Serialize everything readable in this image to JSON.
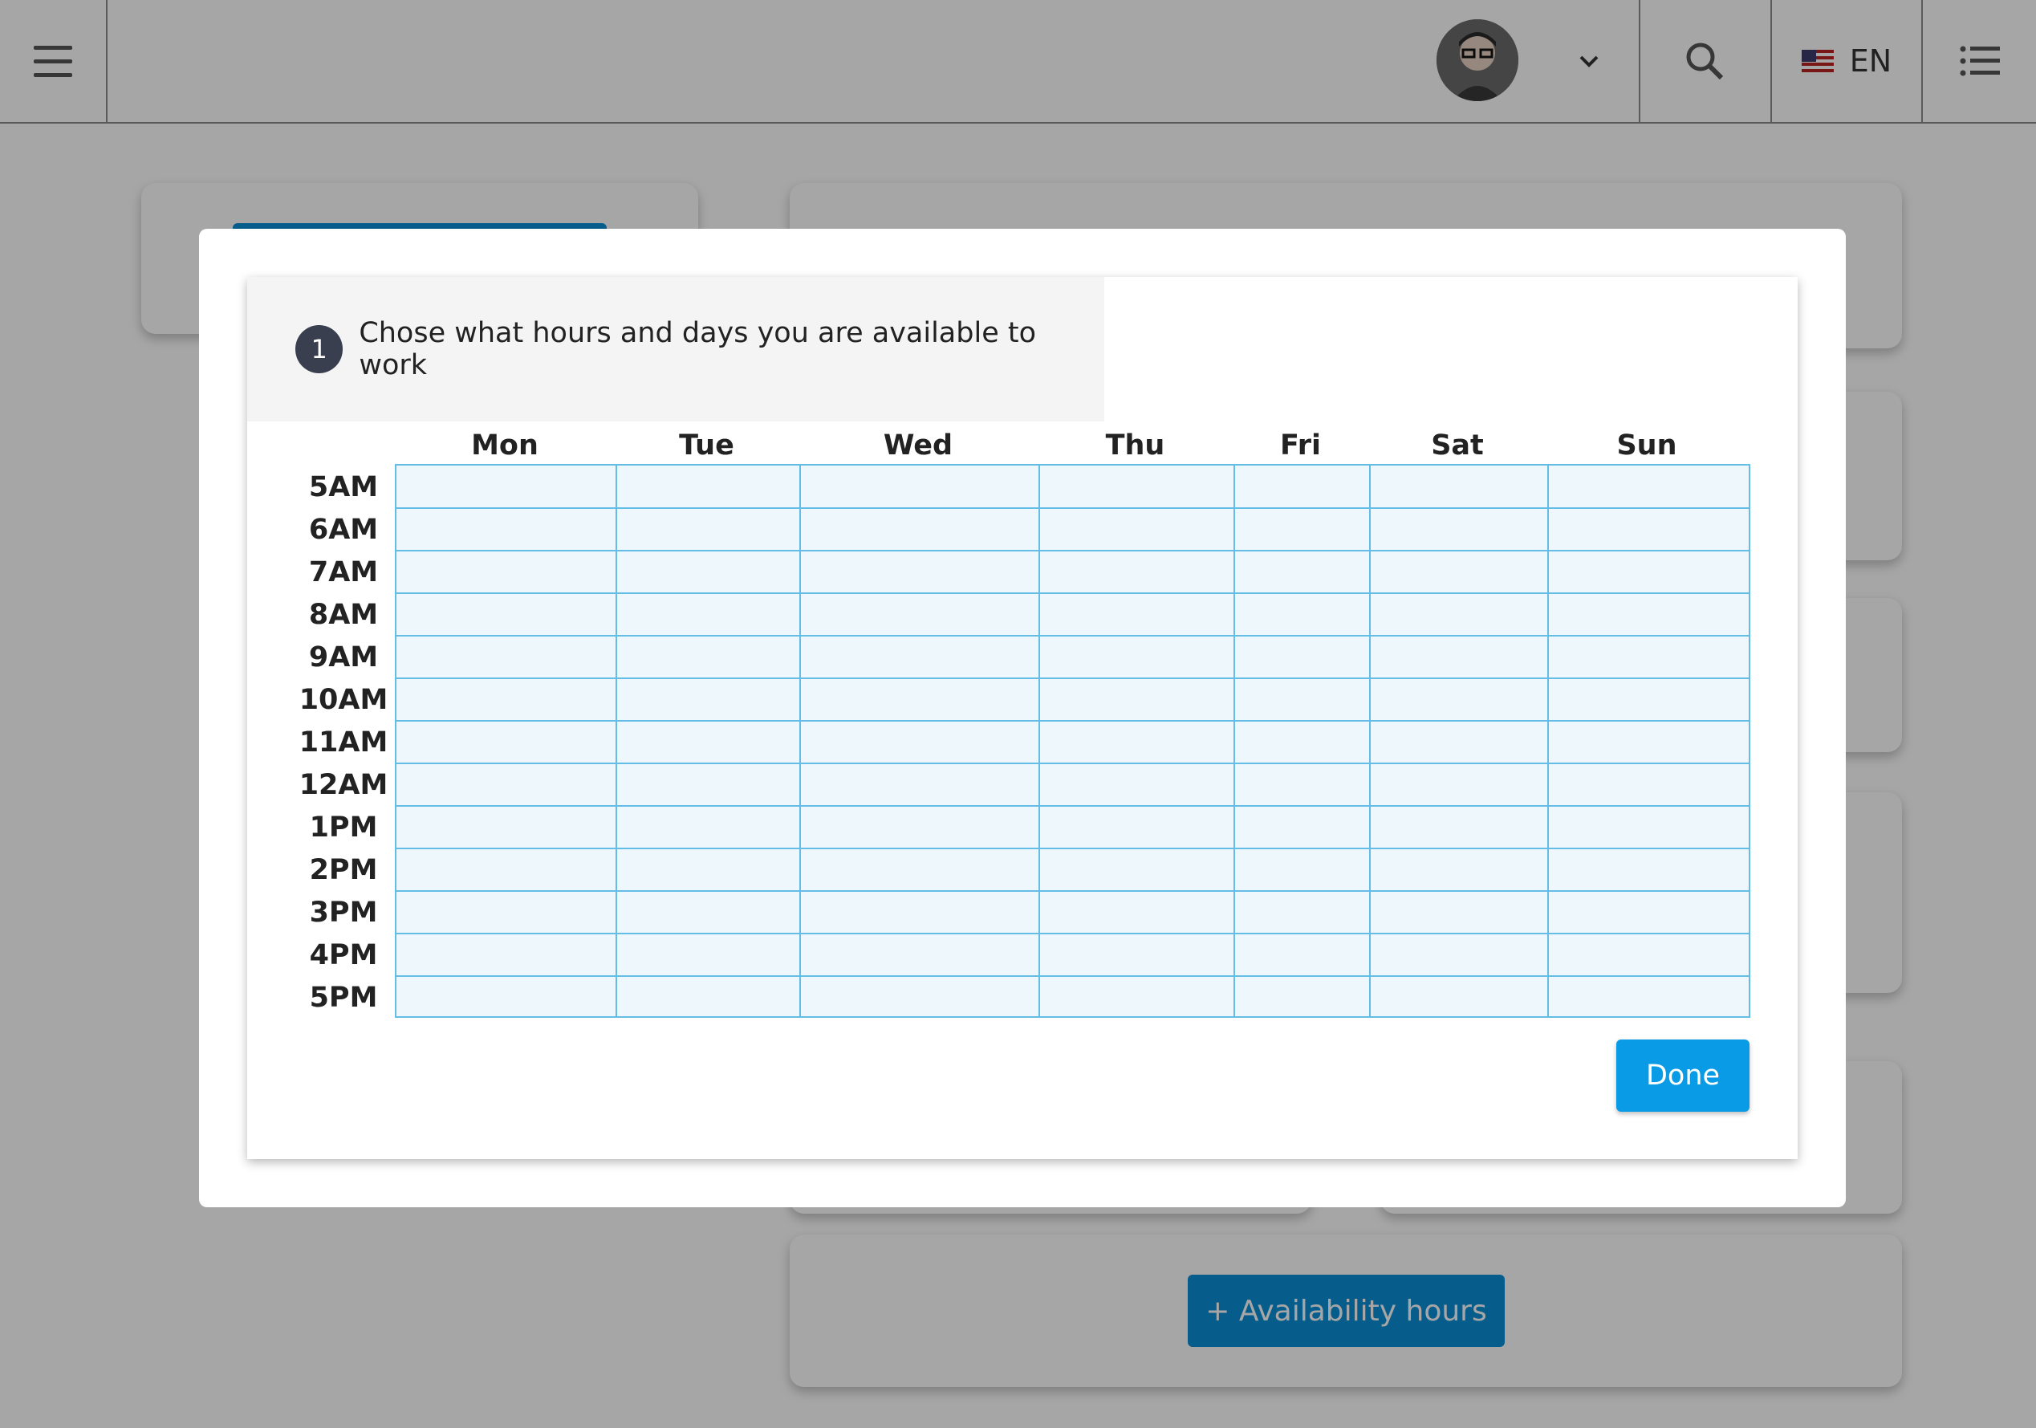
{
  "topbar": {
    "language": "EN",
    "icons": [
      "menu-icon",
      "chevron-down-icon",
      "search-icon",
      "us-flag-icon",
      "list-icon"
    ]
  },
  "background": {
    "add_availability_button": "+ Availability hours",
    "accent_color": "#0a8fd6"
  },
  "modal": {
    "step_number": "1",
    "step_text": "Chose what hours and days you are available to work",
    "days": [
      "Mon",
      "Tue",
      "Wed",
      "Thu",
      "Fri",
      "Sat",
      "Sun"
    ],
    "hours": [
      "5AM",
      "6AM",
      "7AM",
      "8AM",
      "9AM",
      "10AM",
      "11AM",
      "12AM",
      "1PM",
      "2PM",
      "3PM",
      "4PM",
      "5PM"
    ],
    "done_label": "Done",
    "grid_color": "#63bde5",
    "cell_color": "#eef7fb"
  }
}
